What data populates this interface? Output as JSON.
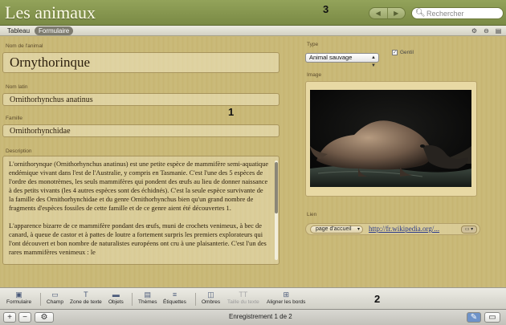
{
  "window": {
    "title": "Les animaux",
    "nav_prev_icon": "◀",
    "nav_next_icon": "▶",
    "search_placeholder": "Rechercher"
  },
  "modebar": {
    "tabs": [
      {
        "label": "Tableau",
        "active": false
      },
      {
        "label": "Formulaire",
        "active": true
      }
    ],
    "right_icons": [
      "gear-icon",
      "minus-icon",
      "layout-icon"
    ]
  },
  "form": {
    "name_label": "Nom de l'animal",
    "name_value": "Ornythorinque",
    "latin_label": "Nom latin",
    "latin_value": "Ornithorhynchus anatinus",
    "family_label": "Famille",
    "family_value": "Ornithorhynchidae",
    "description_label": "Description",
    "description_paragraphs": [
      "L'ornithorynque (Ornithorhynchus anatinus) est une petite espèce de mammifère semi-aquatique endémique vivant dans l'est de l'Australie, y compris en Tasmanie. C'est l'une des 5 espèces de l'ordre des monotrèmes, les seuls mammifères qui pondent des œufs au lieu de donner naissance à des petits vivants (les 4 autres espèces sont des échidnés). C'est la seule espèce survivante de la famille des Ornithorhynchidae et du genre Ornithorhynchus bien qu'un grand nombre de fragments d'espèces fossiles de cette famille et de ce genre aient été découvertes 1.",
      "L'apparence bizarre de ce mammifère pondant des œufs, muni de crochets venimeux, à bec de canard, à queue de castor et à pattes de loutre a fortement surpris les premiers explorateurs qui l'ont découvert et bon nombre de naturalistes européens ont cru à une plaisanterie. C'est l'un des rares mammifères venimeux : le"
    ],
    "type_label": "Type",
    "type_value": "Animal sauvage",
    "gentil_label": "Gentil",
    "gentil_checked": true,
    "image_label": "Image",
    "link_label": "Lien",
    "link_select_value": "page d'accueil",
    "link_url": "http://fr.wikipedia.org/..."
  },
  "markers": [
    "1",
    "2",
    "3"
  ],
  "toolbar": {
    "tools": [
      {
        "label": "Formulaire",
        "icon": "form-icon",
        "enabled": true
      },
      {
        "label": "Champ",
        "icon": "field-icon",
        "enabled": true
      },
      {
        "label": "Zone de texte",
        "icon": "textbox-icon",
        "enabled": true
      },
      {
        "label": "Objets",
        "icon": "objects-icon",
        "enabled": true
      },
      {
        "label": "Thèmes",
        "icon": "themes-icon",
        "enabled": true
      },
      {
        "label": "Étiquettes",
        "icon": "labels-icon",
        "enabled": true
      },
      {
        "label": "Ombres",
        "icon": "shadows-icon",
        "enabled": true
      },
      {
        "label": "Taille du texte",
        "icon": "text-size-icon",
        "enabled": false
      },
      {
        "label": "Aligner les bords",
        "icon": "align-icon",
        "enabled": true
      }
    ]
  },
  "statusbar": {
    "add_icon": "+",
    "remove_icon": "−",
    "gear_icon": "⚙",
    "record_text": "Enregistrement 1 de 2"
  }
}
